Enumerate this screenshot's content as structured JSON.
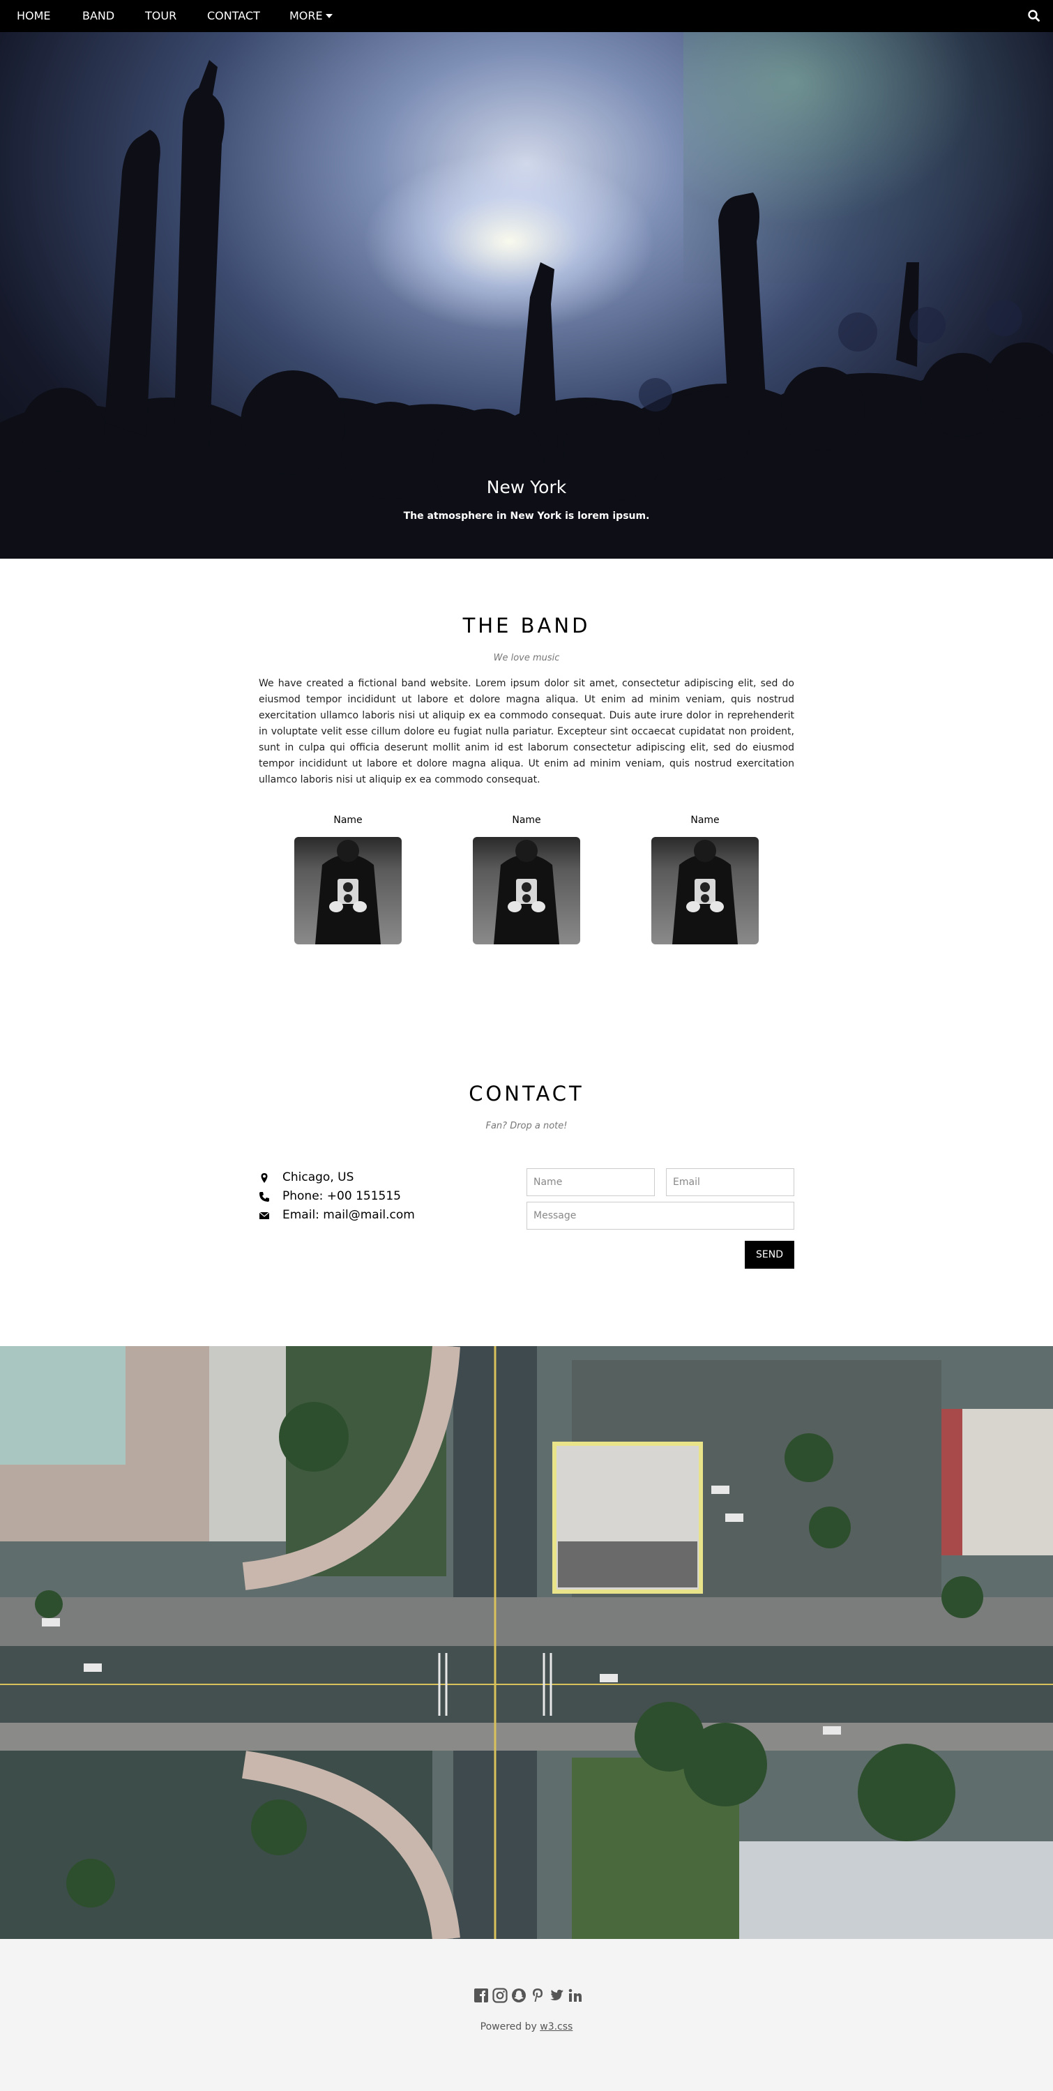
{
  "nav": {
    "items": [
      {
        "label": "HOME"
      },
      {
        "label": "BAND"
      },
      {
        "label": "TOUR"
      },
      {
        "label": "CONTACT"
      },
      {
        "label": "MORE"
      }
    ],
    "search_icon": "search-icon"
  },
  "hero": {
    "title": "New York",
    "subtitle": "The atmosphere in New York is lorem ipsum."
  },
  "band": {
    "title": "THE BAND",
    "tagline": "We love music",
    "text": "We have created a fictional band website. Lorem ipsum dolor sit amet, consectetur adipiscing elit, sed do eiusmod tempor incididunt ut labore et dolore magna aliqua. Ut enim ad minim veniam, quis nostrud exercitation ullamco laboris nisi ut aliquip ex ea commodo consequat. Duis aute irure dolor in reprehenderit in voluptate velit esse cillum dolore eu fugiat nulla pariatur. Excepteur sint occaecat cupidatat non proident, sunt in culpa qui officia deserunt mollit anim id est laborum consectetur adipiscing elit, sed do eiusmod tempor incididunt ut labore et dolore magna aliqua. Ut enim ad minim veniam, quis nostrud exercitation ullamco laboris nisi ut aliquip ex ea commodo consequat.",
    "members": [
      {
        "name": "Name"
      },
      {
        "name": "Name"
      },
      {
        "name": "Name"
      }
    ]
  },
  "contact": {
    "title": "CONTACT",
    "tagline": "Fan? Drop a note!",
    "location": "Chicago, US",
    "phone": "Phone: +00 151515",
    "email": "Email: mail@mail.com",
    "form": {
      "name_placeholder": "Name",
      "email_placeholder": "Email",
      "message_placeholder": "Message",
      "send_label": "SEND"
    },
    "icons": [
      "map-marker-icon",
      "phone-icon",
      "envelope-icon"
    ]
  },
  "footer": {
    "social_icons": [
      "facebook-icon",
      "instagram-icon",
      "snapchat-icon",
      "pinterest-icon",
      "twitter-icon",
      "linkedin-icon"
    ],
    "powered_prefix": "Powered by ",
    "powered_link": "w3.css"
  }
}
